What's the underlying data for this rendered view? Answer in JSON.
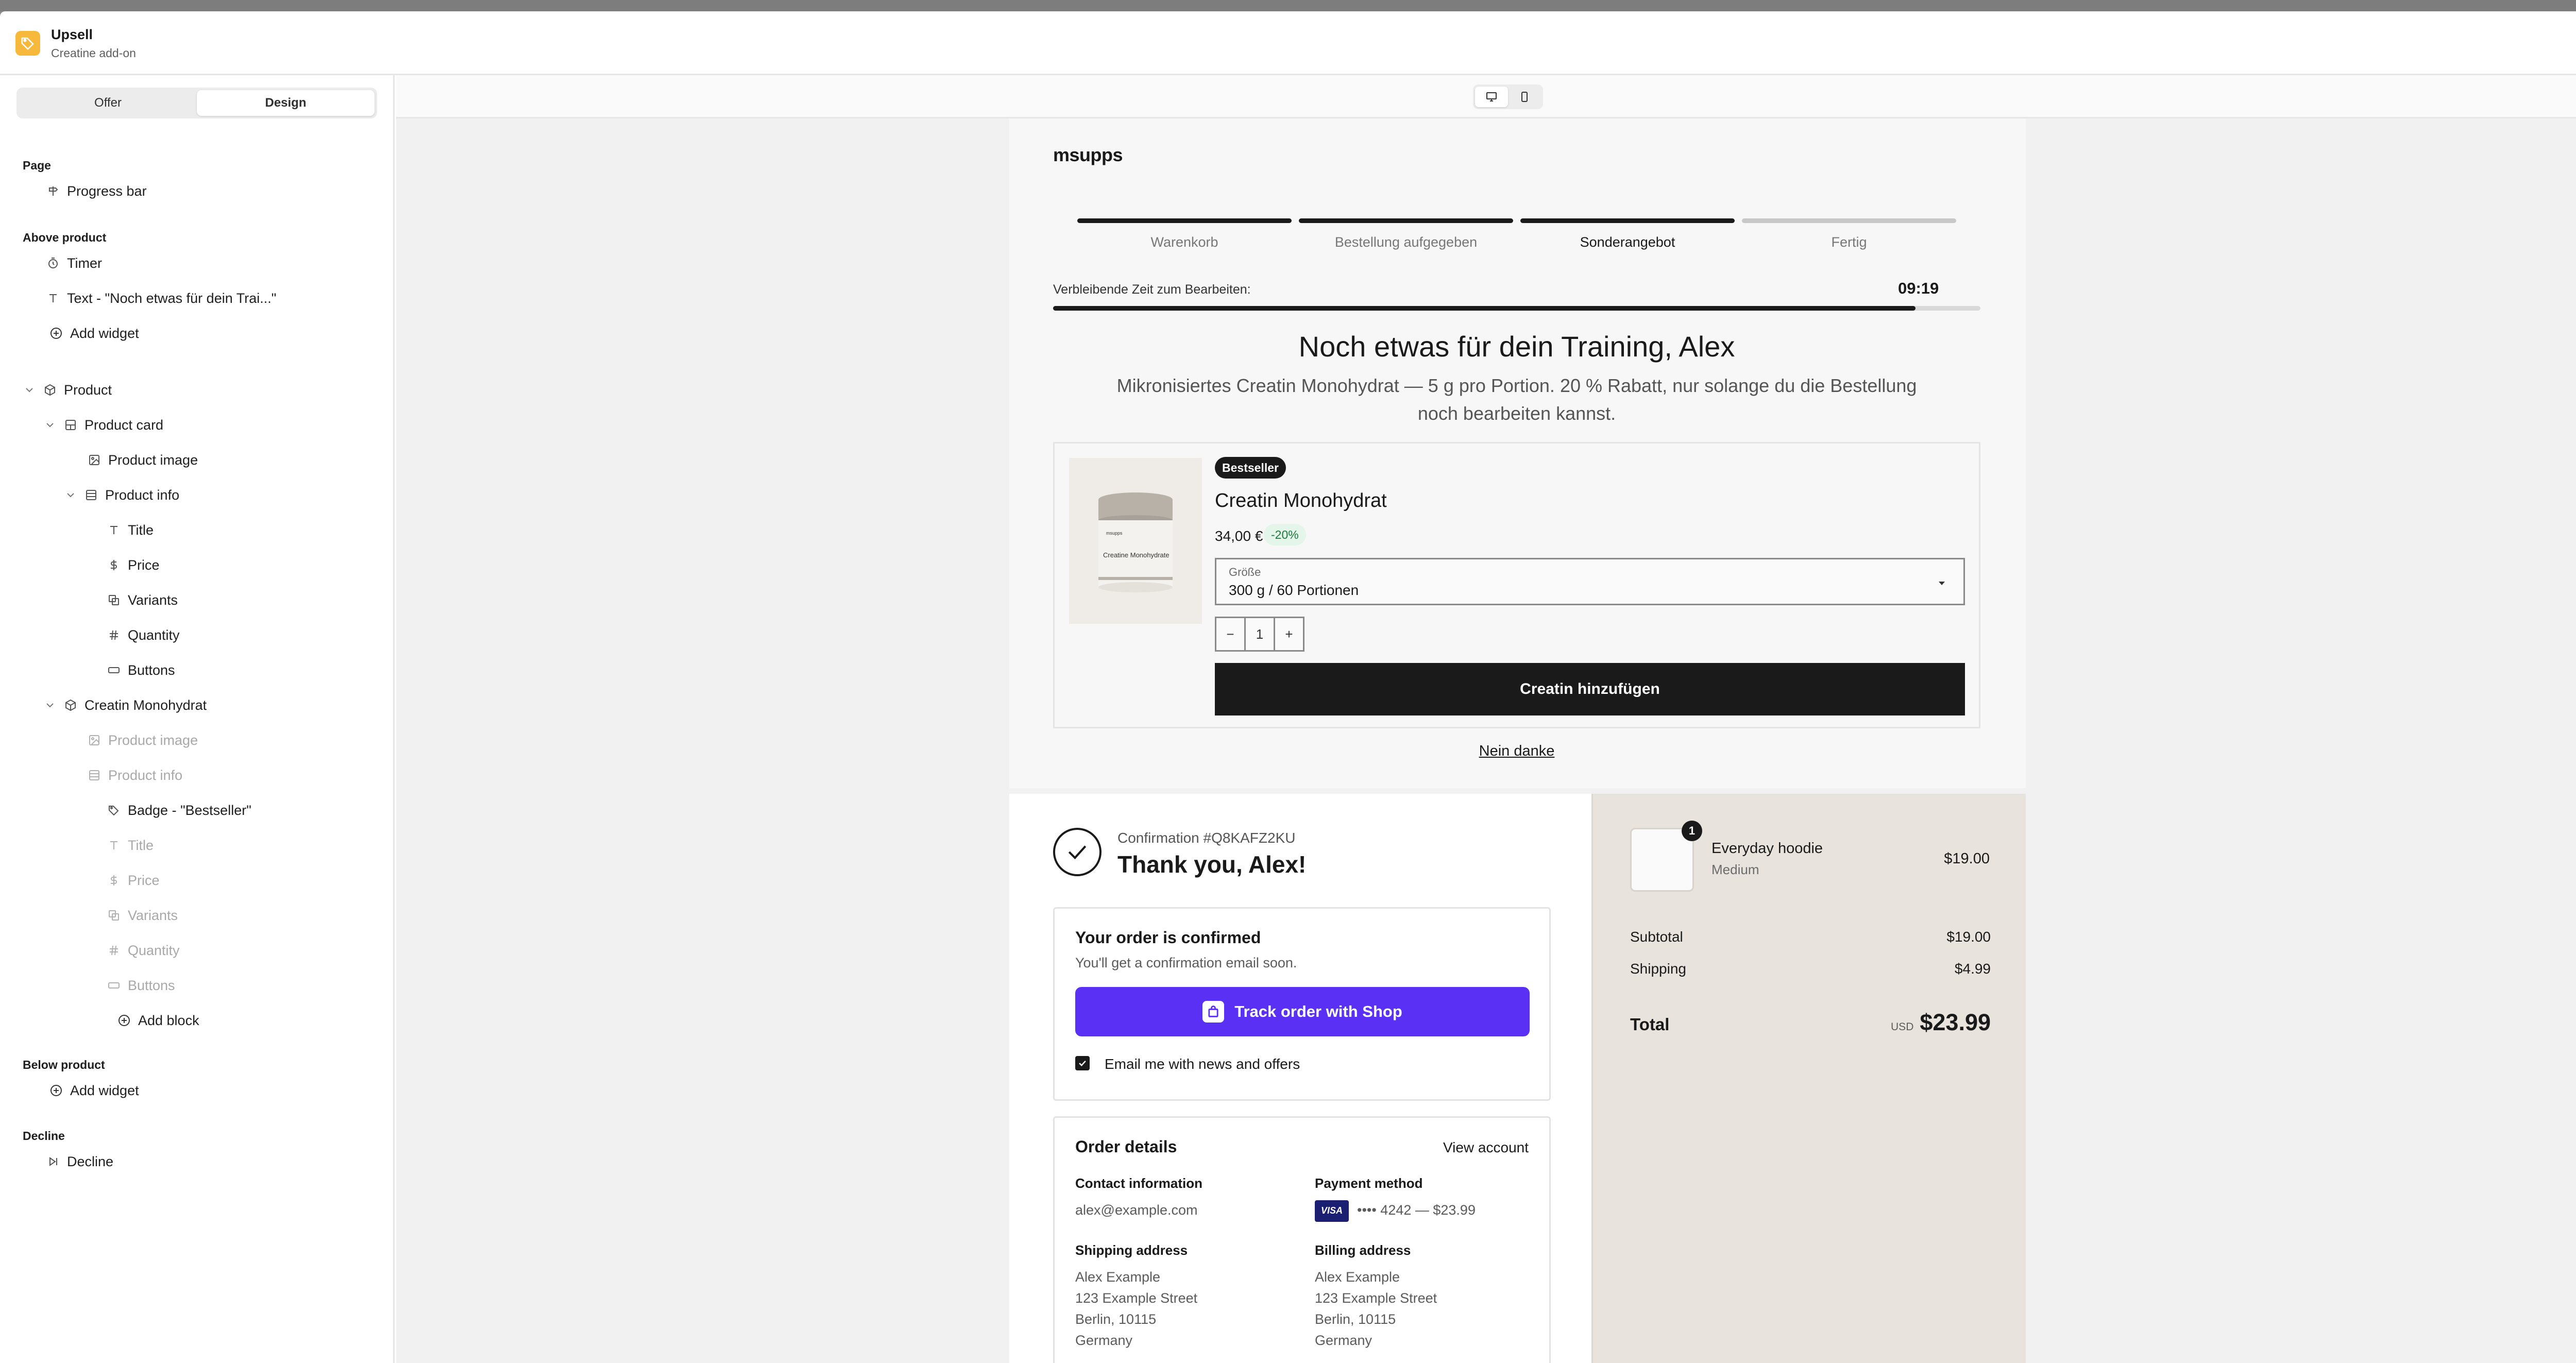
{
  "app": {
    "title": "Upsell",
    "subtitle": "Creatine add-on"
  },
  "tabs": {
    "offer": "Offer",
    "design": "Design"
  },
  "sidebar": {
    "page_label": "Page",
    "progress_bar": "Progress bar",
    "above_label": "Above product",
    "timer": "Timer",
    "text_item": "Text - \"Noch etwas für dein Trai...\"",
    "add_widget": "Add widget",
    "product": "Product",
    "product_card": "Product card",
    "product_image": "Product image",
    "product_info": "Product info",
    "title": "Title",
    "price": "Price",
    "variants": "Variants",
    "quantity": "Quantity",
    "buttons": "Buttons",
    "creatin": "Creatin Monohydrat",
    "badge_item": "Badge - \"Bestseller\"",
    "add_block": "Add block",
    "below_label": "Below product",
    "decline_label": "Decline",
    "decline": "Decline"
  },
  "preview": {
    "brand": "msupps",
    "steps": [
      {
        "label": "Warenkorb",
        "done": true
      },
      {
        "label": "Bestellung aufgegeben",
        "done": true
      },
      {
        "label": "Sonderangebot",
        "done": true
      },
      {
        "label": "Fertig",
        "done": false
      }
    ],
    "timer_label": "Verbleibende Zeit zum Bearbeiten:",
    "timer_value": "09:19",
    "timer_progress": 0.93,
    "headline": "Noch etwas für dein Training, Alex",
    "subtext": "Mikronisiertes Creatin Monohydrat — 5 g pro Portion. 20 % Rabatt, nur solange du die Bestellung noch bearbeiten kannst.",
    "product": {
      "jar_brand": "msupps",
      "jar_label": "Creatine Monohydrate",
      "badge": "Bestseller",
      "title": "Creatin Monohydrat",
      "price": "34,00 €",
      "discount": "-20%",
      "variant_label": "Größe",
      "variant_value": "300 g / 60 Portionen",
      "qty_minus": "−",
      "qty": "1",
      "qty_plus": "+",
      "add_button": "Creatin hinzufügen"
    },
    "decline": "Nein danke"
  },
  "thankyou": {
    "confirmation": "Confirmation #Q8KAFZ2KU",
    "thanks": "Thank you, Alex!",
    "confirmed_title": "Your order is confirmed",
    "confirmed_sub": "You'll get a confirmation email soon.",
    "track_button": "Track order with Shop",
    "email_opt": "Email me with news and offers",
    "details_title": "Order details",
    "view_account": "View account",
    "contact_h": "Contact information",
    "contact_v": "alex@example.com",
    "payment_h": "Payment method",
    "card_brand": "VISA",
    "payment_v": "•••• 4242 — $23.99",
    "shipping_h": "Shipping address",
    "billing_h": "Billing address",
    "address": [
      "Alex Example",
      "123 Example Street",
      "Berlin, 10115",
      "Germany"
    ],
    "item": {
      "qty": "1",
      "name": "Everyday hoodie",
      "variant": "Medium",
      "price": "$19.00"
    },
    "subtotal_l": "Subtotal",
    "subtotal_v": "$19.00",
    "shipping_l": "Shipping",
    "shipping_v": "$4.99",
    "total_l": "Total",
    "currency": "USD",
    "total_v": "$23.99"
  },
  "colors": {
    "accent_shop": "#5a31f4",
    "app_icon": "#f6b93b",
    "discount_bg": "#e4f5e9"
  }
}
